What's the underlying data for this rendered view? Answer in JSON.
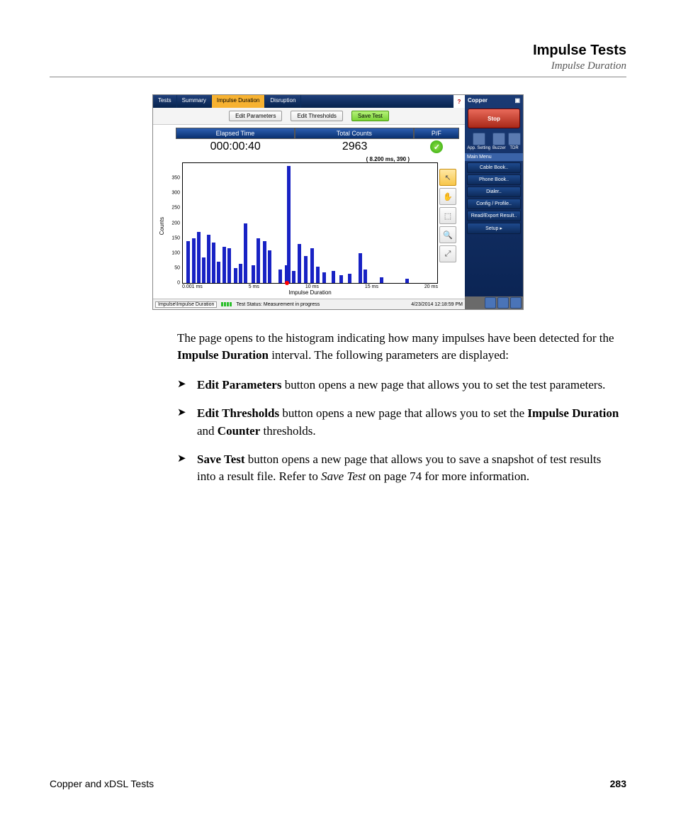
{
  "header": {
    "title": "Impulse Tests",
    "subtitle": "Impulse Duration"
  },
  "screenshot": {
    "tabs": [
      "Tests",
      "Summary",
      "Impulse Duration",
      "Disruption"
    ],
    "active_tab": 2,
    "help_icon": "?",
    "buttons": {
      "edit_params": "Edit Parameters",
      "edit_thresh": "Edit Thresholds",
      "save": "Save Test"
    },
    "cols": {
      "elapsed": "Elapsed Time",
      "counts": "Total Counts",
      "pf": "P/F"
    },
    "vals": {
      "elapsed": "000:00:40",
      "counts": "2963"
    },
    "tooltip": "(  8.200 ms,   390  )",
    "axes": {
      "ylabel": "Counts",
      "xlabel": "Impulse Duration"
    },
    "status": {
      "path": "Impulse\\Impulse Duration",
      "text": "Test Status: Measurement in progress",
      "time": "4/23/2014 12:18:59 PM"
    },
    "side": {
      "title": "Copper",
      "stop": "Stop",
      "minis": [
        "App. Setting",
        "Buzzer",
        "TDR"
      ],
      "menu_hdr": "Main Menu",
      "menu": [
        "Cable Book..",
        "Phone Book..",
        "Dialer..",
        "Config / Profile..",
        "Read/Export Result..",
        "Setup        ▸"
      ]
    }
  },
  "chart_data": {
    "type": "bar",
    "title": "Impulse Duration",
    "xlabel": "Impulse Duration",
    "ylabel": "Counts",
    "ylim": [
      0,
      400
    ],
    "yticks": [
      0,
      50,
      100,
      150,
      200,
      250,
      300,
      350
    ],
    "xticks": [
      "0.001 ms",
      "5 ms",
      "10 ms",
      "15 ms",
      "20 ms"
    ],
    "x_ms": [
      0.3,
      0.7,
      1.1,
      1.5,
      1.9,
      2.3,
      2.7,
      3.1,
      3.5,
      4.0,
      4.4,
      4.8,
      5.4,
      5.8,
      6.3,
      6.7,
      7.5,
      8.0,
      8.2,
      8.6,
      9.0,
      9.5,
      10.0,
      10.5,
      11.0,
      11.7,
      12.3,
      13.0,
      13.8,
      14.2,
      15.5,
      17.5
    ],
    "values": [
      140,
      150,
      170,
      85,
      160,
      135,
      70,
      120,
      115,
      50,
      65,
      200,
      60,
      150,
      140,
      110,
      45,
      60,
      390,
      40,
      130,
      90,
      115,
      55,
      35,
      40,
      25,
      30,
      100,
      45,
      20,
      15
    ],
    "cursor_ms": 8.2,
    "cursor_val": 390
  },
  "body": {
    "intro_a": "The page opens to the histogram indicating how many impulses have been detected for the ",
    "intro_bold": "Impulse Duration",
    "intro_b": " interval. The following parameters are displayed:",
    "items": [
      {
        "lead": "Edit Parameters",
        "rest": " button opens a new page that allows you to set the test parameters."
      },
      {
        "lead": "Edit Thresholds",
        "rest_a": " button opens a new page that allows you to set the ",
        "b1": "Impulse Duration",
        "mid": " and ",
        "b2": "Counter",
        "tail": " thresholds."
      },
      {
        "lead": "Save Test",
        "rest_a": " button opens a new page that allows you to save a snapshot of test results into a result file. Refer to ",
        "i": "Save Test",
        "tail": " on page 74 for more information."
      }
    ]
  },
  "footer": {
    "left": "Copper and xDSL Tests",
    "page": "283"
  }
}
